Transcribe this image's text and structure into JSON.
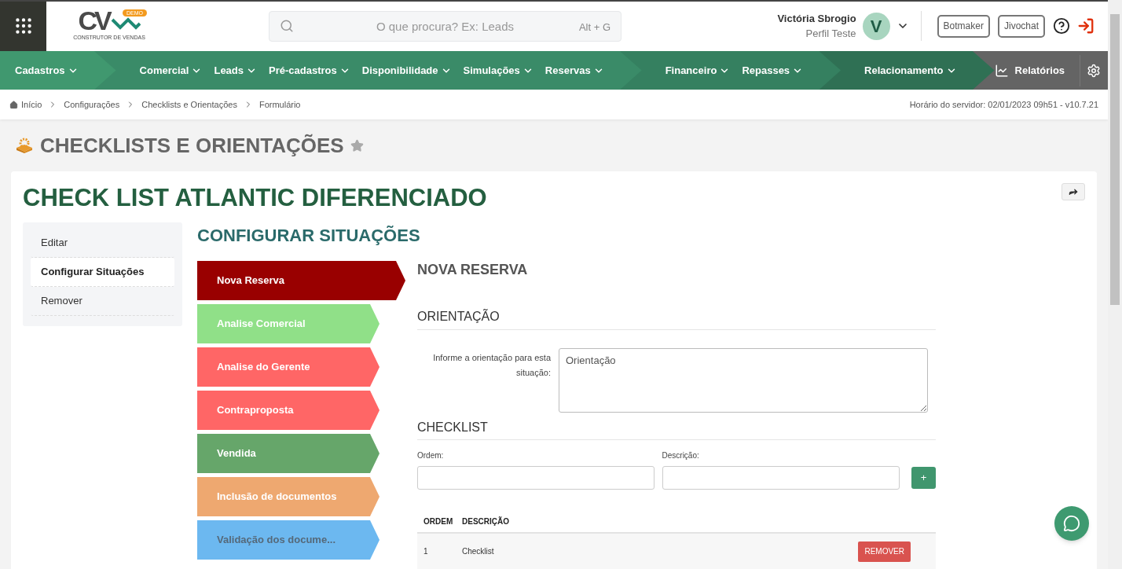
{
  "header": {
    "logo": {
      "letters": "CV",
      "badge": "DEMO",
      "tagline": "CONSTRUTOR DE VENDAS"
    },
    "search": {
      "placeholder": "O que procura? Ex: Leads",
      "shortcut": "Alt + G"
    },
    "user": {
      "name": "Victória Sbrogio",
      "profile": "Perfil Teste",
      "initial": "V"
    },
    "buttons": [
      "Botmaker",
      "Jivochat"
    ]
  },
  "nav": {
    "groups": [
      {
        "color": "#40986f",
        "items": [
          "Cadastros"
        ]
      },
      {
        "color": "#3a8b68",
        "items": [
          "Comercial",
          "Leads",
          "Pré-cadastros",
          "Disponibilidade",
          "Simulações",
          "Reservas"
        ]
      },
      {
        "color": "#358060",
        "items": [
          "Financeiro",
          "Repasses"
        ]
      },
      {
        "color": "#2f7054",
        "items": [
          "Relacionamento"
        ]
      }
    ],
    "reports": "Relatórios"
  },
  "breadcrumb": [
    "Início",
    "Configurações",
    "Checklists e Orientações",
    "Formulário"
  ],
  "server_time": "Horário do servidor: 02/01/2023 09h51 - v10.7.21",
  "page_title": "CHECKLISTS E ORIENTAÇÕES",
  "card": {
    "title": "CHECK LIST ATLANTIC DIFERENCIADO",
    "menu": [
      {
        "label": "Editar",
        "selected": false
      },
      {
        "label": "Configurar Situações",
        "selected": true
      },
      {
        "label": "Remover",
        "selected": false
      }
    ],
    "section_title": "CONFIGURAR SITUAÇÕES",
    "stages": [
      {
        "label": "Nova Reserva",
        "color": "#990000",
        "selected": true,
        "muted": false
      },
      {
        "label": "Analise Comercial",
        "color": "#90e088",
        "selected": false,
        "muted": false
      },
      {
        "label": "Analise do Gerente",
        "color": "#ff6666",
        "selected": false,
        "muted": false
      },
      {
        "label": "Contraproposta",
        "color": "#ff6666",
        "selected": false,
        "muted": false
      },
      {
        "label": "Vendida",
        "color": "#66a66a",
        "selected": false,
        "muted": false
      },
      {
        "label": "Inclusão de documentos",
        "color": "#eea870",
        "selected": false,
        "muted": false
      },
      {
        "label": "Validação dos docume...",
        "color": "#6cb8f0",
        "selected": false,
        "muted": true
      }
    ],
    "detail": {
      "title": "NOVA RESERVA",
      "orientation_heading": "ORIENTAÇÃO",
      "orientation_label": "Informe a orientação para esta situação:",
      "orientation_value": "Orientação",
      "checklist_heading": "CHECKLIST",
      "order_label": "Ordem:",
      "description_label": "Descrição:",
      "add_button": "+",
      "table": {
        "columns": [
          "ORDEM",
          "DESCRIÇÃO"
        ],
        "rows": [
          {
            "order": "1",
            "description": "Checklist",
            "action": "REMOVER"
          }
        ]
      }
    }
  }
}
